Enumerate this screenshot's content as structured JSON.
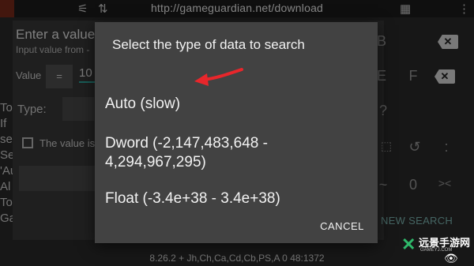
{
  "top_bar": {
    "url": "http://gameguardian.net/download"
  },
  "background_dialog": {
    "title": "Enter a value",
    "subtitle": "Input value from -",
    "value_label": "Value",
    "operator": "=",
    "value_text": "10",
    "type_label": "Type:",
    "checkbox_label": "The value is",
    "side_lines": [
      "To",
      "If",
      "se",
      "Se",
      "'Au",
      "Al",
      "To",
      "Ga"
    ]
  },
  "keyboard": {
    "keys": [
      "B",
      "E",
      "F",
      "?",
      "~",
      "0",
      "><",
      ":"
    ],
    "new_search_label": "NEW SEARCH"
  },
  "status_bar": {
    "text": "8.26.2  + Jh,Ch,Ca,Cd,Cb,PS,A  0  48:1372"
  },
  "modal": {
    "title": "Select the type of data to search",
    "options": [
      {
        "label": "Auto (slow)"
      },
      {
        "label": "Dword (-2,147,483,648 - 4,294,967,295)"
      },
      {
        "label": "Float (-3.4e+38 - 3.4e+38)"
      }
    ],
    "cancel_label": "CANCEL"
  },
  "annotation": {
    "arrow_color": "#e8262b"
  },
  "watermark": {
    "text": "远景手游网",
    "subtext": "GAMEYJ.COM"
  },
  "icons": {
    "delete": "backspace-icon",
    "history": "history-icon",
    "eye": "eye-icon"
  }
}
